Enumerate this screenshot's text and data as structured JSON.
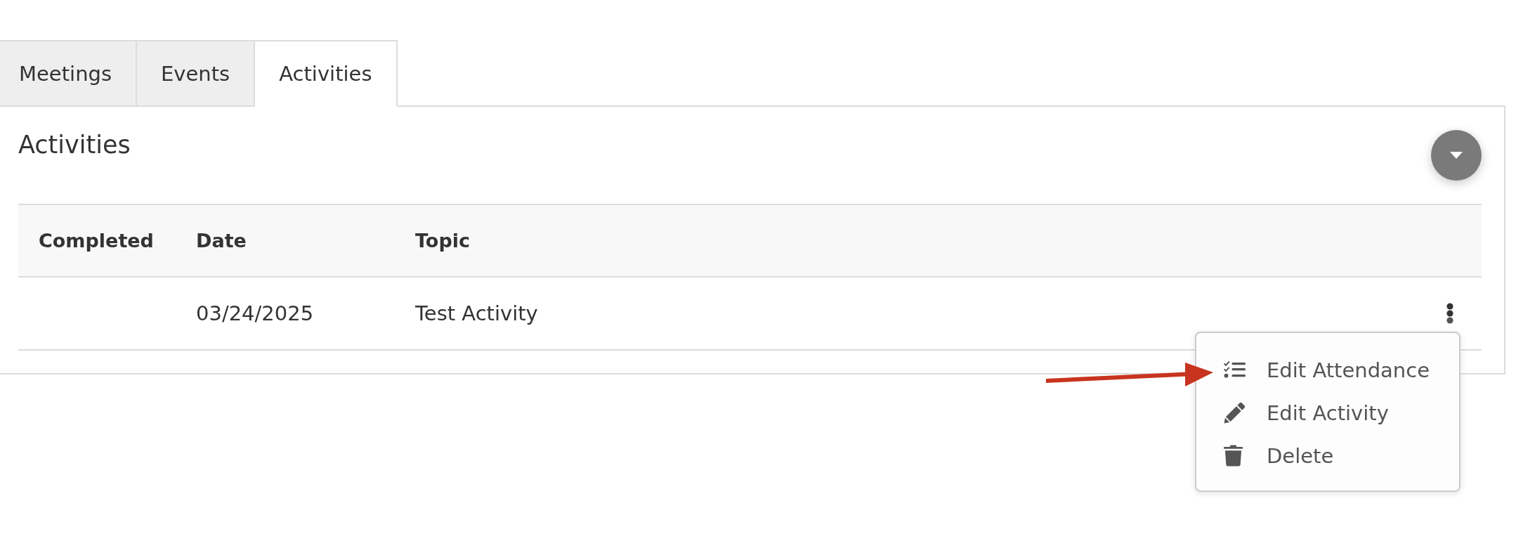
{
  "tabs": [
    {
      "label": "Meetings",
      "selected": false
    },
    {
      "label": "Events",
      "selected": false
    },
    {
      "label": "Activities",
      "selected": true
    }
  ],
  "panel": {
    "title": "Activities"
  },
  "table": {
    "columns": [
      "Completed",
      "Date",
      "Topic"
    ],
    "rows": [
      {
        "date": "03/24/2025",
        "topic": "Test Activity"
      }
    ]
  },
  "row_menu": {
    "items": [
      {
        "label": "Edit Attendance"
      },
      {
        "label": "Edit Activity"
      },
      {
        "label": "Delete"
      }
    ]
  }
}
